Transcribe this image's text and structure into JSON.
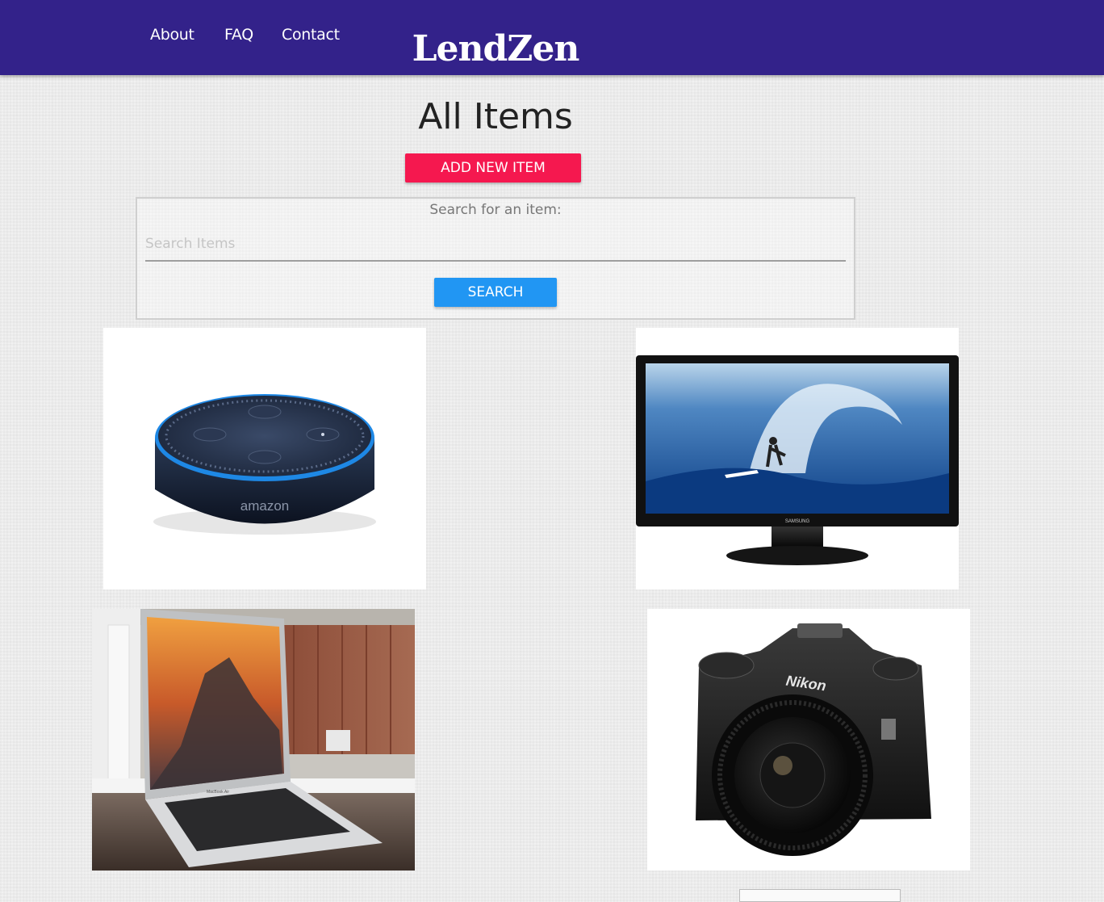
{
  "nav": {
    "links": [
      "About",
      "FAQ",
      "Contact"
    ],
    "brand": "LendZen"
  },
  "main": {
    "title": "All Items",
    "add_button": "ADD NEW ITEM",
    "search": {
      "label": "Search for an item:",
      "placeholder": "Search Items",
      "value": "",
      "button": "SEARCH"
    }
  },
  "items": [
    {
      "image": "smart-speaker",
      "brand_text": "amazon"
    },
    {
      "image": "computer-monitor",
      "brand_text": "SAMSUNG"
    },
    {
      "image": "laptop",
      "brand_text": "MacBook Air"
    },
    {
      "image": "dslr-camera",
      "brand_text": "Nikon"
    }
  ],
  "colors": {
    "navbar": "#33228a",
    "add_button": "#f5184f",
    "search_button": "#2196f3"
  }
}
